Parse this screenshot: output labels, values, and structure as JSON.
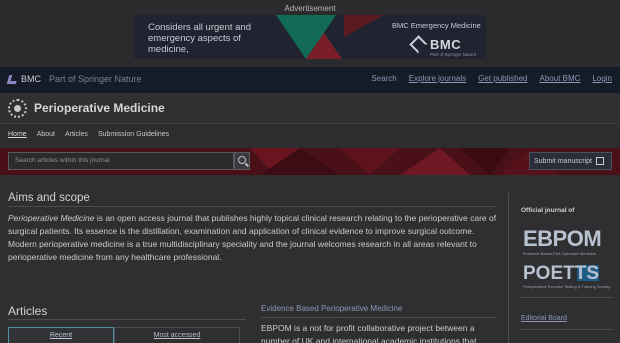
{
  "advertisement": {
    "label": "Advertisement",
    "banner_text": "Considers all urgent and emergency aspects of medicine,",
    "banner_brand": "BMC Emergency Medicine",
    "banner_logo": "BMC",
    "banner_sub": "Part of Springer Nature"
  },
  "topnav": {
    "brand": "BMC",
    "brand_suffix": "Part of Springer Nature",
    "links": [
      "Search",
      "Explore journals",
      "Get published",
      "About BMC",
      "Login"
    ]
  },
  "journal": {
    "title": "Perioperative Medicine"
  },
  "subnav": {
    "items": [
      "Home",
      "About",
      "Articles",
      "Submission Guidelines"
    ]
  },
  "search": {
    "placeholder": "Search articles within this journal",
    "submit_label": "Submit manuscript"
  },
  "aims": {
    "title": "Aims and scope",
    "journal_name": "Perioperative Medicine",
    "body": " is an open access journal that publishes highly topical clinical research relating to the perioperative care of surgical patients. Its essence is the distillation, examination and application of clinical evidence to improve surgical outcome. Modern perioperative medicine is a true multidisciplinary speciality and the journal welcomes research in all areas relevant to perioperative medicine from any healthcare professional."
  },
  "articles": {
    "title": "Articles",
    "tabs": [
      "Recent",
      "Most accessed"
    ]
  },
  "ebpom": {
    "link": "Evidence Based Perioperative Medicine",
    "body": "EBPOM is a not for profit collaborative project between a number of UK and international academic institutions that"
  },
  "sidebar": {
    "official_label": "Official journal of",
    "logo1_text": "EBPOM",
    "logo1_sub": "Evidence Based Peri-Operative Medicine",
    "logo2_text": "POETTS",
    "logo2_sub": "Perioperative Exercise Testing & Training Society",
    "editorial_board": "Editorial Board"
  },
  "colors": {
    "page_bg": "#2f2f31",
    "topnav_bg": "#151b27",
    "link": "#8d97b7",
    "band": "#4a1018"
  }
}
